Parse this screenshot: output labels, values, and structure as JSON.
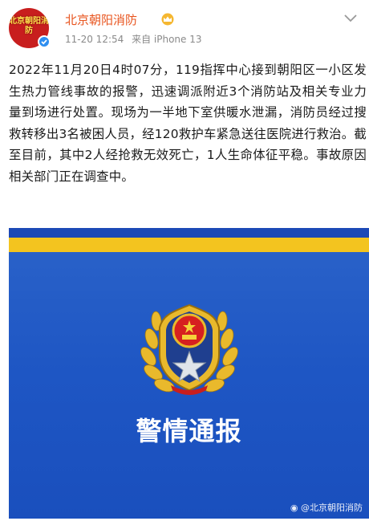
{
  "header": {
    "avatar_text": "北京朝阳消防",
    "username": "北京朝阳消防",
    "timestamp": "11-20 12:54",
    "source": "来自 iPhone 13"
  },
  "post": {
    "text": "2022年11月20日4时07分，119指挥中心接到朝阳区一小区发生热力管线事故的报警，迅速调派附近3个消防站及相关专业力量到场进行处置。现场为一半地下室供暖水泄漏，消防员经过搜救转移出3名被困人员，经120救护车紧急送往医院进行救治。截至目前，其中2人经抢救无效死亡，1人生命体征平稳。事故原因相关部门正在调查中。"
  },
  "image": {
    "title": "警情通报",
    "watermark": "@北京朝阳消防"
  },
  "icons": {
    "verified": "verified-icon",
    "vip": "vip-crown-icon",
    "more": "more-chevron-icon",
    "emblem": "fire-rescue-emblem-icon",
    "weibo": "weibo-logo-icon"
  },
  "colors": {
    "username": "#e8541e",
    "image_blue": "#1e56c4",
    "stripe_yellow": "#f3c41f",
    "verified_blue": "#2e8ef0"
  }
}
